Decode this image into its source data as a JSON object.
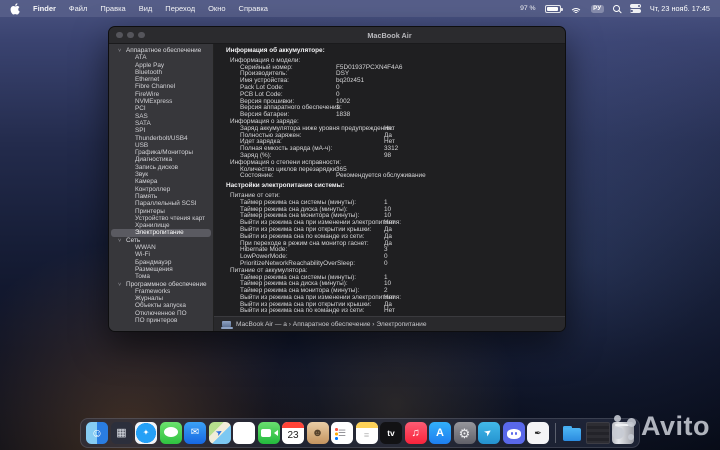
{
  "menu_bar": {
    "apple_icon": "apple-logo",
    "items": [
      "Finder",
      "Файл",
      "Правка",
      "Вид",
      "Переход",
      "Окно",
      "Справка"
    ],
    "status": {
      "battery_pct": "97 %",
      "input_source": "РУ",
      "clock": "Чт, 23 нояб. 17:45"
    }
  },
  "window": {
    "title": "MacBook Air",
    "sidebar": {
      "chevron_icon": "˅",
      "selected": "Электропитание",
      "sections": [
        {
          "label": "Аппаратное обеспечение",
          "items": [
            "ATA",
            "Apple Pay",
            "Bluetooth",
            "Ethernet",
            "Fibre Channel",
            "FireWire",
            "NVMExpress",
            "PCI",
            "SAS",
            "SATA",
            "SPI",
            "Thunderbolt/USB4",
            "USB",
            "Графика/Мониторы",
            "Диагностика",
            "Запись дисков",
            "Звук",
            "Камера",
            "Контроллер",
            "Память",
            "Параллельный SCSI",
            "Принтеры",
            "Устройство чтения карт",
            "Хранилище",
            "Электропитание"
          ]
        },
        {
          "label": "Сеть",
          "items": [
            "WWAN",
            "Wi-Fi",
            "Брандмауэр",
            "Размещения",
            "Тома"
          ]
        },
        {
          "label": "Программное обеспечение",
          "items": [
            "Frameworks",
            "Журналы",
            "Объекты запуска",
            "Отключенное ПО",
            "ПО принтеров"
          ]
        }
      ]
    },
    "content": {
      "blocks": [
        {
          "type": "h1",
          "text": "Информация об аккумуляторе:"
        },
        {
          "type": "gap"
        },
        {
          "type": "section",
          "title": "Информация о модели:",
          "col": "a",
          "rows": [
            [
              "Серийный номер:",
              "F5D01937PCXN4F4A6"
            ],
            [
              "Производитель:",
              "DSY"
            ],
            [
              "Имя устройства:",
              "bq20z451"
            ],
            [
              "Pack Lot Code:",
              "0"
            ],
            [
              "PCB Lot Code:",
              "0"
            ],
            [
              "Версия прошивки:",
              "1002"
            ],
            [
              "Версия аппаратного обеспечения:",
              "1"
            ],
            [
              "Версия батареи:",
              "1838"
            ]
          ]
        },
        {
          "type": "section",
          "title": "Информация о заряде:",
          "col": "b",
          "rows": [
            [
              "Заряд аккумулятора ниже уровня предупреждения:",
              "Нет"
            ],
            [
              "Полностью заряжен:",
              "Да"
            ],
            [
              "Идет зарядка:",
              "Нет"
            ],
            [
              "Полная емкость заряда (мА-ч):",
              "3312"
            ],
            [
              "Заряд (%):",
              "98"
            ]
          ]
        },
        {
          "type": "section",
          "title": "Информация о степени исправности:",
          "col": "a",
          "rows": [
            [
              "Количество циклов перезарядки:",
              "365"
            ],
            [
              "Состояние:",
              "Рекомендуется обслуживание"
            ]
          ]
        },
        {
          "type": "gap"
        },
        {
          "type": "h1",
          "text": "Настройки электропитания системы:"
        },
        {
          "type": "gap"
        },
        {
          "type": "section",
          "title": "Питание от сети:",
          "col": "b",
          "rows": [
            [
              "Таймер режима сна системы (минуты):",
              "1"
            ],
            [
              "Таймер режима сна диска (минуты):",
              "10"
            ],
            [
              "Таймер режима сна монитора (минуты):",
              "10"
            ],
            [
              "Выйти из режима сна при изменении электропитания:",
              "Нет"
            ],
            [
              "Выйти из режима сна при открытии крышки:",
              "Да"
            ],
            [
              "Выйти из режима сна по команде из сети:",
              "Да"
            ],
            [
              "При переходе в режим сна монитор гаснет:",
              "Да"
            ],
            [
              "Hibernate Mode:",
              "3"
            ],
            [
              "LowPowerMode:",
              "0"
            ],
            [
              "PrioritizeNetworkReachabilityOverSleep:",
              "0"
            ]
          ]
        },
        {
          "type": "section",
          "title": "Питание от аккумулятора:",
          "col": "b",
          "rows": [
            [
              "Таймер режима сна системы (минуты):",
              "1"
            ],
            [
              "Таймер режима сна диска (минуты):",
              "10"
            ],
            [
              "Таймер режима сна монитора (минуты):",
              "2"
            ],
            [
              "Выйти из режима сна при изменении электропитания:",
              "Нет"
            ],
            [
              "Выйти из режима сна при открытии крышки:",
              "Да"
            ],
            [
              "Выйти из режима сна по команде из сети:",
              "Нет"
            ]
          ]
        }
      ]
    },
    "statusbar": {
      "path": "MacBook Air — a  ›  Аппаратное обеспечение  ›  Электропитание"
    }
  },
  "dock": {
    "apps": [
      {
        "name": "finder",
        "glyph": "☺"
      },
      {
        "name": "launchpad",
        "glyph": "▦"
      },
      {
        "name": "safari",
        "glyph": "✦"
      },
      {
        "name": "messages",
        "glyph": ""
      },
      {
        "name": "mail",
        "glyph": "✉"
      },
      {
        "name": "maps",
        "glyph": "➤"
      },
      {
        "name": "photos",
        "glyph": ""
      },
      {
        "name": "facetime",
        "glyph": ""
      },
      {
        "name": "calendar",
        "glyph": "23"
      },
      {
        "name": "contacts",
        "glyph": "☻"
      },
      {
        "name": "reminders",
        "glyph": "☰"
      },
      {
        "name": "notes",
        "glyph": "≡"
      },
      {
        "name": "tv",
        "glyph": "tv"
      },
      {
        "name": "music",
        "glyph": "♫"
      },
      {
        "name": "app-store",
        "glyph": "A"
      },
      {
        "name": "settings",
        "glyph": "⚙"
      },
      {
        "name": "telegram",
        "glyph": "➤"
      },
      {
        "name": "discord",
        "glyph": ""
      },
      {
        "name": "white-app",
        "glyph": "✒"
      },
      {
        "name": "divider"
      },
      {
        "name": "downloads-folder",
        "glyph": ""
      },
      {
        "name": "minimized-window",
        "glyph": ""
      },
      {
        "name": "trash",
        "glyph": ""
      }
    ]
  },
  "watermark": {
    "text": "Avito"
  }
}
